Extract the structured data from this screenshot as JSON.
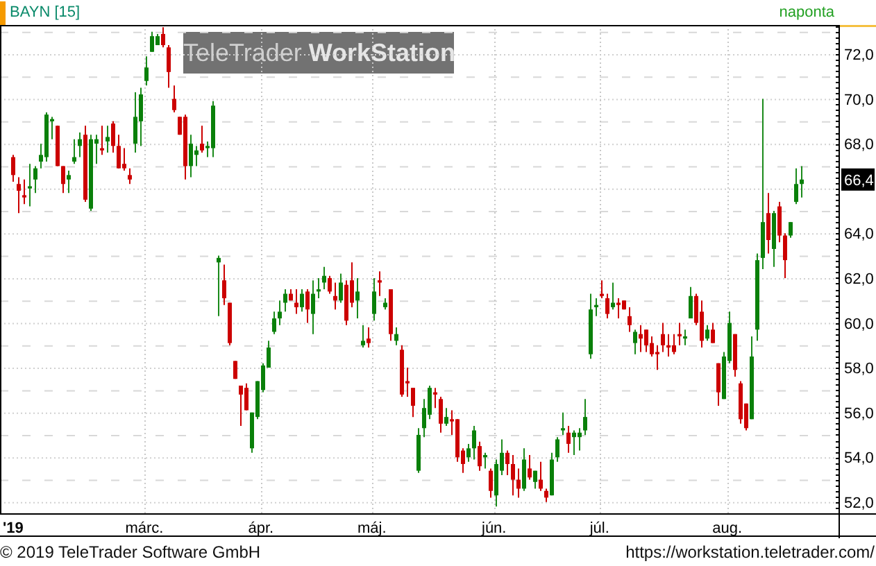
{
  "header": {
    "symbol": "BAYN [15]",
    "interval": "naponta"
  },
  "chart": {
    "brand_overlay": "TeleTrader **WorkStation**",
    "last_price": "66,4",
    "chart_data": {
      "type": "candlestick",
      "grid": true,
      "ylim": [
        51.5,
        73.3
      ],
      "categories": [
        "'19",
        null,
        null,
        null,
        null,
        null,
        null,
        null,
        null,
        null,
        null,
        null,
        null,
        null,
        null,
        null,
        null,
        null,
        null,
        null,
        null,
        null,
        null,
        null,
        "márc.",
        null,
        null,
        null,
        null,
        null,
        null,
        null,
        null,
        null,
        null,
        null,
        null,
        null,
        null,
        null,
        null,
        null,
        null,
        null,
        null,
        "ápr.",
        null,
        null,
        null,
        null,
        null,
        null,
        null,
        null,
        null,
        null,
        null,
        null,
        null,
        null,
        null,
        null,
        null,
        null,
        null,
        "máj.",
        null,
        null,
        null,
        null,
        null,
        null,
        null,
        null,
        null,
        null,
        null,
        null,
        null,
        null,
        null,
        null,
        null,
        null,
        null,
        null,
        null,
        "jún.",
        null,
        null,
        null,
        null,
        null,
        null,
        null,
        null,
        null,
        null,
        null,
        null,
        null,
        null,
        null,
        null,
        null,
        null,
        "júl.",
        null,
        null,
        null,
        null,
        null,
        null,
        null,
        null,
        null,
        null,
        null,
        null,
        null,
        null,
        null,
        null,
        null,
        null,
        null,
        null,
        null,
        null,
        "aug.",
        null,
        null,
        null,
        null,
        null,
        null,
        null,
        null,
        null,
        null,
        null,
        null,
        null
      ],
      "yticks": [
        {
          "value": 52,
          "label": "52,0"
        },
        {
          "value": 54,
          "label": "54,0"
        },
        {
          "value": 56,
          "label": "56,0"
        },
        {
          "value": 58,
          "label": "58,0"
        },
        {
          "value": 60,
          "label": "60,0"
        },
        {
          "value": 62,
          "label": "62,0"
        },
        {
          "value": 64,
          "label": "64,0"
        },
        {
          "value": 68,
          "label": "68,0"
        },
        {
          "value": 70,
          "label": "70,0"
        },
        {
          "value": 72,
          "label": "72,0"
        }
      ],
      "ohlc": [
        [
          67.4,
          67.5,
          66.3,
          66.6
        ],
        [
          66.2,
          66.5,
          64.9,
          65.9
        ],
        [
          65.7,
          66.4,
          65.3,
          65.6
        ],
        [
          66.0,
          67.1,
          65.2,
          66.1
        ],
        [
          66.4,
          67.0,
          65.8,
          66.9
        ],
        [
          67.2,
          68.0,
          66.9,
          67.5
        ],
        [
          67.4,
          69.4,
          67.2,
          69.3
        ],
        [
          69.0,
          69.2,
          68.2,
          69.1
        ],
        [
          68.8,
          68.8,
          67.0,
          67.0
        ],
        [
          67.0,
          67.0,
          65.8,
          66.2
        ],
        [
          66.4,
          66.8,
          65.8,
          66.6
        ],
        [
          67.2,
          68.2,
          67.1,
          67.4
        ],
        [
          67.9,
          68.5,
          67.4,
          68.2
        ],
        [
          68.4,
          68.8,
          65.4,
          65.5
        ],
        [
          65.1,
          68.4,
          65.0,
          68.2
        ],
        [
          68.0,
          68.4,
          67.1,
          68.2
        ],
        [
          67.8,
          68.8,
          67.5,
          67.7
        ],
        [
          68.1,
          68.8,
          67.6,
          68.3
        ],
        [
          68.9,
          69.0,
          67.6,
          67.9
        ],
        [
          67.9,
          68.4,
          66.9,
          66.9
        ],
        [
          67.1,
          67.8,
          66.8,
          66.9
        ],
        [
          66.6,
          66.9,
          66.2,
          66.4
        ],
        [
          68.0,
          70.3,
          67.6,
          69.2
        ],
        [
          69.0,
          70.5,
          67.9,
          70.2
        ],
        [
          70.8,
          71.9,
          70.6,
          71.4
        ],
        [
          72.1,
          73.0,
          72.1,
          72.8
        ],
        [
          72.4,
          72.9,
          72.4,
          72.8
        ],
        [
          72.9,
          73.2,
          72.3,
          72.4
        ],
        [
          72.3,
          72.4,
          70.5,
          71.2
        ],
        [
          70.0,
          70.6,
          69.4,
          69.5
        ],
        [
          69.2,
          69.2,
          68.4,
          68.4
        ],
        [
          69.2,
          69.3,
          66.4,
          67.0
        ],
        [
          67.0,
          68.4,
          66.5,
          68.0
        ],
        [
          67.5,
          67.9,
          67.0,
          67.7
        ],
        [
          68.0,
          68.8,
          67.6,
          67.7
        ],
        [
          67.8,
          68.1,
          67.4,
          67.9
        ],
        [
          67.8,
          69.9,
          67.4,
          69.7
        ],
        [
          62.7,
          63.0,
          60.3,
          62.9
        ],
        [
          61.9,
          62.6,
          60.8,
          61.1
        ],
        [
          60.9,
          60.9,
          59.0,
          59.1
        ],
        [
          58.3,
          58.3,
          57.5,
          57.5
        ],
        [
          57.2,
          57.2,
          55.4,
          56.8
        ],
        [
          57.1,
          57.3,
          56.1,
          56.1
        ],
        [
          54.4,
          56.0,
          54.2,
          56.0
        ],
        [
          55.8,
          57.4,
          55.7,
          57.4
        ],
        [
          57.0,
          58.2,
          56.9,
          58.1
        ],
        [
          58.0,
          59.2,
          58.0,
          58.9
        ],
        [
          59.6,
          60.5,
          59.5,
          60.2
        ],
        [
          60.2,
          61.0,
          59.9,
          60.5
        ],
        [
          60.9,
          61.5,
          60.5,
          61.3
        ],
        [
          61.3,
          61.5,
          61.0,
          61.0
        ],
        [
          60.9,
          61.5,
          60.4,
          60.7
        ],
        [
          60.7,
          61.5,
          60.5,
          61.3
        ],
        [
          61.4,
          61.5,
          60.0,
          60.6
        ],
        [
          60.4,
          61.9,
          59.5,
          61.3
        ],
        [
          61.4,
          62.0,
          61.1,
          61.5
        ],
        [
          61.8,
          62.5,
          61.5,
          62.1
        ],
        [
          62.0,
          62.1,
          61.3,
          61.4
        ],
        [
          61.2,
          61.8,
          60.6,
          61.0
        ],
        [
          61.0,
          62.2,
          60.9,
          61.8
        ],
        [
          61.7,
          61.9,
          59.9,
          60.1
        ],
        [
          61.9,
          62.7,
          60.7,
          60.9
        ],
        [
          61.0,
          62.0,
          60.2,
          61.4
        ],
        [
          59.0,
          59.9,
          58.9,
          59.2
        ],
        [
          59.3,
          59.8,
          58.9,
          59.1
        ],
        [
          60.4,
          62.0,
          60.1,
          61.4
        ],
        [
          61.9,
          62.3,
          61.2,
          61.8
        ],
        [
          60.7,
          61.1,
          60.6,
          60.9
        ],
        [
          61.5,
          61.5,
          59.2,
          59.5
        ],
        [
          59.2,
          59.8,
          59.0,
          59.5
        ],
        [
          58.8,
          59.0,
          56.7,
          56.8
        ],
        [
          57.4,
          58.0,
          56.7,
          57.3
        ],
        [
          57.1,
          57.1,
          55.8,
          56.3
        ],
        [
          53.4,
          55.3,
          53.3,
          55.0
        ],
        [
          55.3,
          56.6,
          54.9,
          56.2
        ],
        [
          55.9,
          57.2,
          55.7,
          57.1
        ],
        [
          56.9,
          57.1,
          56.2,
          56.8
        ],
        [
          56.6,
          56.7,
          55.1,
          55.5
        ],
        [
          55.5,
          56.2,
          55.4,
          55.8
        ],
        [
          55.7,
          56.1,
          55.0,
          55.6
        ],
        [
          55.7,
          55.7,
          53.8,
          54.0
        ],
        [
          54.3,
          54.4,
          53.3,
          53.7
        ],
        [
          54.0,
          54.6,
          53.8,
          54.4
        ],
        [
          54.4,
          55.4,
          53.9,
          55.2
        ],
        [
          54.5,
          54.7,
          53.4,
          53.6
        ],
        [
          54.0,
          54.2,
          53.5,
          54.1
        ],
        [
          53.4,
          53.5,
          52.2,
          52.5
        ],
        [
          52.3,
          53.9,
          51.8,
          53.7
        ],
        [
          53.4,
          54.8,
          53.2,
          54.2
        ],
        [
          54.2,
          54.3,
          53.2,
          53.7
        ],
        [
          53.7,
          54.1,
          52.3,
          53.0
        ],
        [
          53.0,
          53.5,
          52.2,
          52.6
        ],
        [
          52.6,
          54.4,
          52.5,
          53.9
        ],
        [
          53.5,
          54.1,
          53.0,
          53.1
        ],
        [
          52.9,
          53.4,
          52.6,
          53.4
        ],
        [
          53.0,
          53.8,
          52.5,
          52.6
        ],
        [
          52.5,
          52.6,
          52.0,
          52.2
        ],
        [
          52.3,
          54.2,
          52.3,
          53.9
        ],
        [
          54.0,
          54.9,
          53.8,
          54.8
        ],
        [
          55.2,
          56.0,
          55.0,
          55.3
        ],
        [
          55.1,
          55.4,
          54.2,
          54.6
        ],
        [
          54.9,
          55.2,
          54.1,
          55.1
        ],
        [
          54.9,
          55.3,
          54.3,
          55.1
        ],
        [
          55.2,
          56.6,
          55.0,
          55.8
        ],
        [
          58.6,
          61.3,
          58.4,
          60.6
        ],
        [
          60.7,
          61.1,
          60.3,
          60.8
        ],
        [
          61.3,
          61.9,
          61.1,
          61.2
        ],
        [
          61.1,
          61.3,
          60.2,
          60.4
        ],
        [
          60.7,
          61.8,
          60.6,
          60.9
        ],
        [
          60.9,
          61.1,
          60.2,
          60.8
        ],
        [
          61.0,
          61.0,
          60.6,
          60.6
        ],
        [
          60.3,
          60.7,
          59.6,
          59.9
        ],
        [
          59.1,
          59.7,
          58.6,
          59.6
        ],
        [
          59.5,
          59.9,
          58.7,
          59.3
        ],
        [
          59.7,
          59.7,
          58.7,
          59.0
        ],
        [
          59.1,
          59.4,
          58.5,
          58.6
        ],
        [
          58.7,
          59.0,
          57.9,
          58.6
        ],
        [
          59.5,
          60.0,
          58.7,
          59.0
        ],
        [
          59.0,
          59.5,
          58.5,
          58.9
        ],
        [
          59.0,
          59.5,
          58.6,
          58.7
        ],
        [
          59.5,
          60.0,
          59.0,
          59.4
        ],
        [
          59.3,
          59.7,
          59.0,
          59.4
        ],
        [
          60.2,
          61.6,
          60.2,
          61.2
        ],
        [
          61.2,
          61.3,
          59.9,
          60.0
        ],
        [
          60.5,
          61.0,
          58.9,
          59.2
        ],
        [
          59.3,
          59.9,
          59.2,
          59.7
        ],
        [
          59.7,
          60.0,
          59.1,
          59.1
        ],
        [
          58.2,
          58.2,
          56.3,
          56.9
        ],
        [
          56.6,
          58.7,
          56.6,
          58.5
        ],
        [
          58.3,
          60.5,
          58.2,
          60.0
        ],
        [
          59.5,
          59.5,
          57.6,
          57.9
        ],
        [
          57.3,
          57.4,
          55.5,
          55.7
        ],
        [
          56.4,
          56.4,
          55.2,
          55.3
        ],
        [
          55.7,
          59.4,
          55.7,
          58.5
        ],
        [
          59.7,
          63.1,
          59.2,
          62.8
        ],
        [
          62.9,
          70.0,
          62.4,
          64.5
        ],
        [
          64.9,
          65.8,
          63.1,
          63.7
        ],
        [
          63.3,
          65.0,
          62.5,
          64.9
        ],
        [
          65.2,
          65.4,
          63.6,
          63.9
        ],
        [
          63.9,
          64.0,
          62.0,
          62.8
        ],
        [
          63.9,
          64.5,
          63.8,
          64.5
        ],
        [
          65.4,
          66.9,
          65.3,
          66.2
        ],
        [
          66.2,
          67.0,
          65.6,
          66.4
        ]
      ]
    }
  },
  "footer": {
    "copyright": "© 2019 TeleTrader Software GmbH",
    "url": "https://workstation.teletrader.com/"
  }
}
